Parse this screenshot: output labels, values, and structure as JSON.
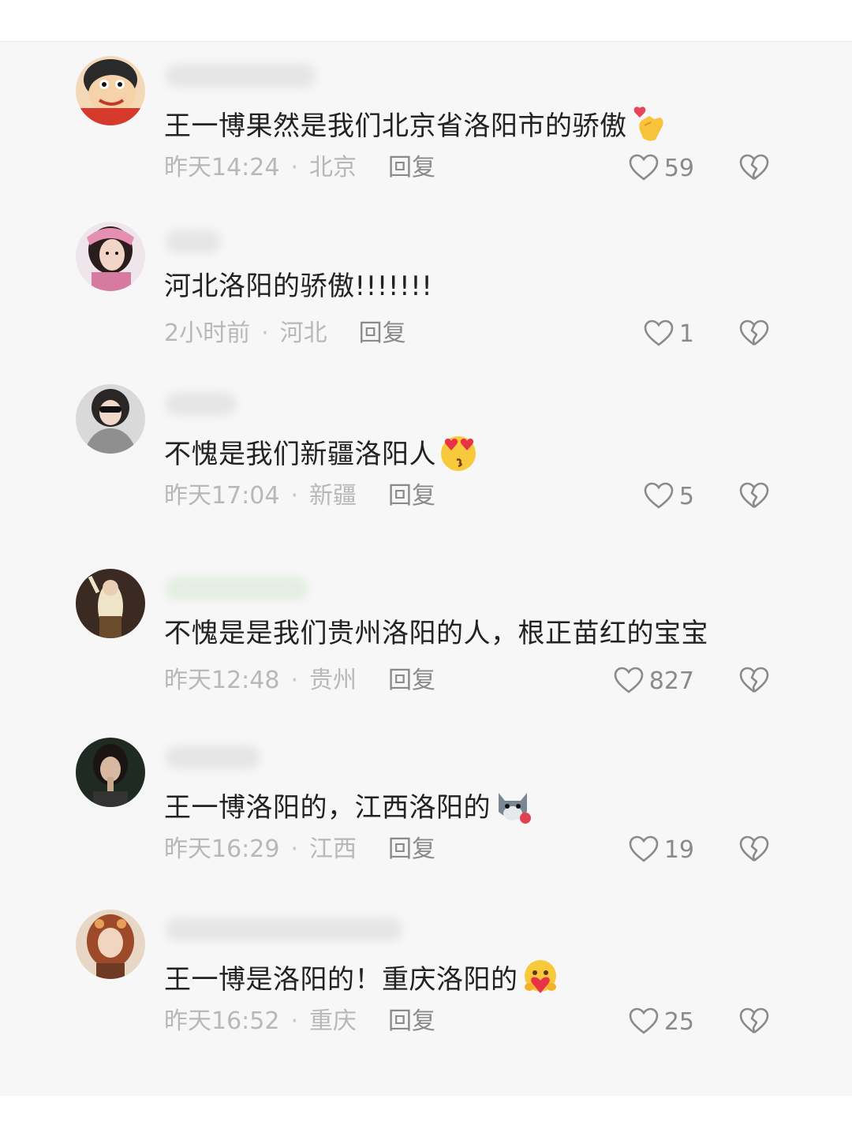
{
  "comments": [
    {
      "text": "王一博果然是我们北京省洛阳市的骄傲",
      "emoji_icon": "finger-heart-icon",
      "time": "昨天14:24",
      "location": "北京",
      "reply_label": "回复",
      "likes": "59"
    },
    {
      "text": "河北洛阳的骄傲!!!!!!!",
      "emoji_icon": "",
      "time": "2小时前",
      "location": "河北",
      "reply_label": "回复",
      "likes": "1"
    },
    {
      "text": "不愧是我们新疆洛阳人",
      "emoji_icon": "kissing-heart-eyes-icon",
      "time": "昨天17:04",
      "location": "新疆",
      "reply_label": "回复",
      "likes": "5"
    },
    {
      "text": "不愧是是我们贵州洛阳的人，根正苗红的宝宝",
      "emoji_icon": "",
      "time": "昨天12:48",
      "location": "贵州",
      "reply_label": "回复",
      "likes": "827"
    },
    {
      "text": "王一博洛阳的，江西洛阳的",
      "emoji_icon": "dog-rose-icon",
      "time": "昨天16:29",
      "location": "江西",
      "reply_label": "回复",
      "likes": "19"
    },
    {
      "text": "王一博是洛阳的！重庆洛阳的",
      "emoji_icon": "hugging-heart-icon",
      "time": "昨天16:52",
      "location": "重庆",
      "reply_label": "回复",
      "likes": "25"
    }
  ],
  "icons": {
    "like": "heart-outline-icon",
    "dislike": "broken-heart-icon"
  },
  "colors": {
    "text": "#222222",
    "meta": "#b8b8b8",
    "action": "#8a8a8a",
    "background": "#f7f7f7"
  }
}
